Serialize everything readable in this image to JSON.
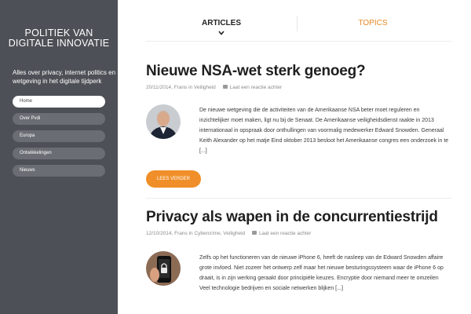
{
  "site": {
    "title_line1": "POLITIEK VAN",
    "title_line2": "DIGITALE INNOVATIE",
    "description": "Alles over privacy, internet politics en wetgeving in het digitale tijdperk"
  },
  "nav": {
    "items": [
      {
        "label": "Home",
        "active": true
      },
      {
        "label": "Over Pvdi"
      },
      {
        "label": "Europa"
      },
      {
        "label": "Ontwikkelingen"
      },
      {
        "label": "Nieuws"
      }
    ]
  },
  "tabs": {
    "articles": "ARTICLES",
    "topics": "TOPICS"
  },
  "posts": [
    {
      "title": "Nieuwe NSA-wet sterk genoeg?",
      "date": "20/11/2014",
      "category": "Frans in Veiligheid",
      "comments": "Laat een reactie achter",
      "excerpt": "De nieuwe wetgeving die de activiteiten van de Amerikaanse NSA beter moet reguleren en inzichtelijker moet maken, ligt nu bij de Senaat. De Amerikaanse veiligheidsdienst raakte in 2013 internationaal in opspraak door onthullingen van voormalig medewerker Edward Snowden. Generaal Keith Alexander op het matje Eind oktober 2013 besloot het Amerikaanse congres een onderzoek in te [...]",
      "read_more": "LEES VERDER"
    },
    {
      "title": "Privacy als wapen in de concurrentiestrijd",
      "date": "12/10/2014",
      "category": "Frans in Cybercrime, Veiligheid",
      "comments": "Laat een reactie achter",
      "excerpt": "Zelfs op het functioneren van de nieuwe iPhone 6, heeft de nasleep van de Edward Snowden affaire grote invloed. Niet zozeer het ontwerp zelf maar het nieuwe besturingssysteem waar de iPhone 6 op draait, is in zijn werking geraakt door principiële keuzes. Encryptie door niemand meer te omzeilen Veel  technologie bedrijven en sociale netwerken blijken [...]"
    }
  ],
  "colors": {
    "sidebar": "#4d5056",
    "accent": "#f08f29",
    "topics_tab": "#e48b25"
  },
  "icons": [
    "chevron-down-icon",
    "comment-icon"
  ]
}
